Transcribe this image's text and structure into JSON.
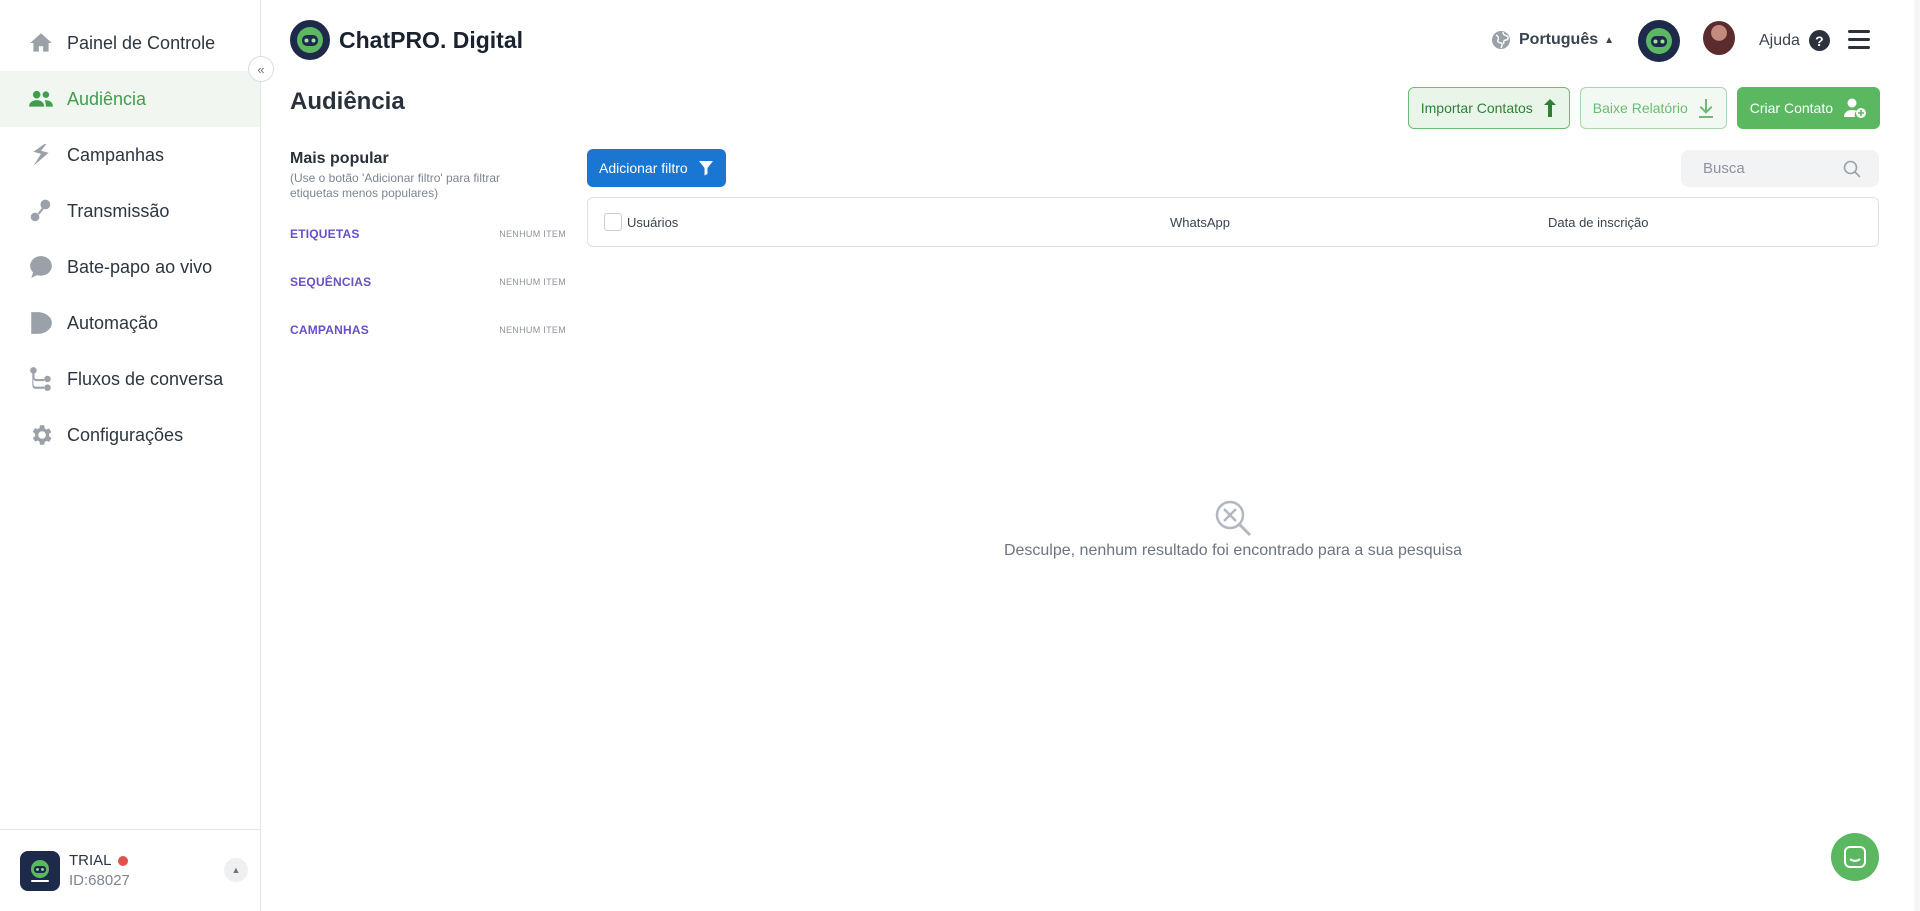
{
  "brand": {
    "name": "ChatPRO. Digital"
  },
  "sidebar": {
    "items": [
      {
        "label": "Painel de Controle",
        "icon": "home-icon"
      },
      {
        "label": "Audiência",
        "icon": "people-icon",
        "active": true
      },
      {
        "label": "Campanhas",
        "icon": "campaign-icon"
      },
      {
        "label": "Transmissão",
        "icon": "broadcast-icon"
      },
      {
        "label": "Bate-papo ao vivo",
        "icon": "chat-bubble-icon"
      },
      {
        "label": "Automação",
        "icon": "automation-icon"
      },
      {
        "label": "Fluxos de conversa",
        "icon": "flow-icon"
      },
      {
        "label": "Configurações",
        "icon": "gear-icon"
      }
    ],
    "account": {
      "plan": "TRIAL",
      "id": "ID:68027",
      "status_color": "#e0534a"
    }
  },
  "header": {
    "language": "Português",
    "help_label": "Ajuda"
  },
  "page": {
    "title": "Audiência",
    "actions": {
      "import_label": "Importar Contatos",
      "report_label": "Baixe Relatório",
      "create_label": "Criar Contato"
    }
  },
  "filters": {
    "title": "Mais popular",
    "hint": "(Use o botão 'Adicionar filtro' para filtrar etiquetas menos populares)",
    "groups": [
      {
        "label": "ETIQUETAS",
        "count": "NENHUM ITEM"
      },
      {
        "label": "SEQUÊNCIAS",
        "count": "NENHUM ITEM"
      },
      {
        "label": "CAMPANHAS",
        "count": "NENHUM ITEM"
      }
    ],
    "add_filter_label": "Adicionar filtro"
  },
  "search": {
    "placeholder": "Busca"
  },
  "table": {
    "columns": [
      "Usuários",
      "WhatsApp",
      "Data de inscrição"
    ]
  },
  "empty_state": {
    "message": "Desculpe, nenhum resultado foi encontrado para a sua pesquisa"
  },
  "colors": {
    "accent_green": "#5cb860",
    "primary_blue": "#1976d2",
    "filter_purple": "#6a4fc4"
  }
}
